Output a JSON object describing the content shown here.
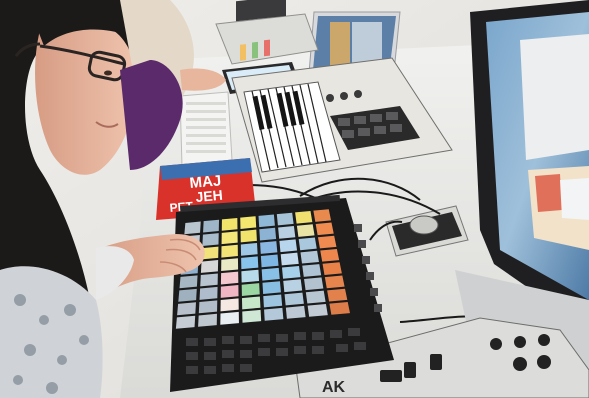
{
  "photo": {
    "subject": "student-playing-grid-controller",
    "magazine_text_line1": "MAJ",
    "magazine_text_line2": "JEH",
    "magazine_text_line3": "PET",
    "brand_text": "AK",
    "pad_grid": {
      "rows": 8,
      "cols": 8,
      "colors": [
        [
          "#b9c6d0",
          "#9fb6c8",
          "#f2e36b",
          "#f3e76f",
          "#8fb7d6",
          "#a6c3d8",
          "#f0e070",
          "#e88a4e"
        ],
        [
          "#c2cbd3",
          "#a9bccb",
          "#f5e87a",
          "#f1e36c",
          "#8cb3d3",
          "#b8d0e2",
          "#e9e3a6",
          "#f08c4f"
        ],
        [
          "#9db3c7",
          "#f2e27a",
          "#f4e676",
          "#9fc7e6",
          "#8ab8e3",
          "#b7d6ed",
          "#a9c7dd",
          "#ef8a50"
        ],
        [
          "#8fb1cf",
          "#d7d7d7",
          "#e9e9c6",
          "#89c4ec",
          "#7fb7e4",
          "#c4dced",
          "#b2c8d9",
          "#ed874d"
        ],
        [
          "#a6b6c3",
          "#b8c4cf",
          "#f3c8cf",
          "#b7dbe9",
          "#89c0e6",
          "#a6d0ea",
          "#aec3d3",
          "#e98249"
        ],
        [
          "#9fb0bf",
          "#aebccb",
          "#f0b6c3",
          "#9bd7a2",
          "#88bee2",
          "#b9d2e3",
          "#b2c2cf",
          "#e7854e"
        ],
        [
          "#b8c1cb",
          "#b1bdc9",
          "#f5e7e2",
          "#c6e7c8",
          "#9ec5df",
          "#aec7d9",
          "#b8c6d2",
          "#e3814c"
        ],
        [
          "#c6ccd4",
          "#bfc7cf",
          "#e8eef1",
          "#cfe7d5",
          "#b3c9d9",
          "#bcc9d5",
          "#c2cbd4",
          "#dd7d49"
        ]
      ]
    },
    "colors": {
      "wall": "#f2f1ef",
      "desk": "#e9e9e7",
      "controller_body": "#1b1b1c",
      "hair": "#1c1a18",
      "skin": "#e8b59d",
      "monitor_screen": "#6f98bf",
      "keyboard_body": "#e8e6e1"
    }
  }
}
